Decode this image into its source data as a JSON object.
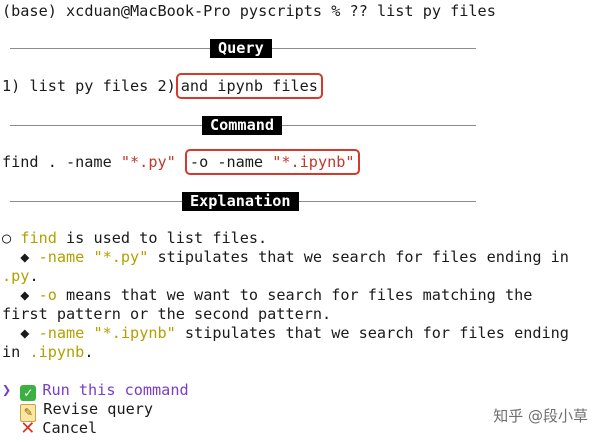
{
  "prompt": {
    "env": "(base)",
    "user_host": "xcduan@MacBook-Pro",
    "cwd": "pyscripts",
    "symbol": "%",
    "command": "?? list py files"
  },
  "sections": {
    "query": "Query",
    "command": "Command",
    "explanation": "Explanation"
  },
  "query": {
    "part1": "1) list py files 2)",
    "part2": "and ipynb files"
  },
  "command": {
    "base": "find . -name",
    "arg1": "\"*.py\"",
    "flag": "-o -name",
    "arg2": "\"*.ipynb\""
  },
  "explanation": {
    "bullet_main": "○",
    "bullet_sub": "◆",
    "l1_code": "find",
    "l1_text": " is used to list files.",
    "l2_code": "-name \"*.py\"",
    "l2_text": " stipulates that we search for files ending in",
    "l3_code": ".py",
    "l3_text": ".",
    "l4_code": "-o",
    "l4_text": " means that we want to search for files matching the",
    "l5_text": "first pattern or the second pattern.",
    "l6_code": "-name \"*.ipynb\"",
    "l6_text": " stipulates that we search for files ending",
    "l7_pre": "in ",
    "l7_code": ".ipynb",
    "l7_text": "."
  },
  "menu": {
    "pointer": "❯",
    "items": [
      {
        "icon": "check-mark-button-icon",
        "label": "Run this command"
      },
      {
        "icon": "memo-icon",
        "label": "Revise query"
      },
      {
        "icon": "cross-mark-icon",
        "label": "Cancel"
      }
    ]
  },
  "watermark": "知乎 @段小草",
  "colors": {
    "highlight_box": "#d33a2c",
    "code_yellow": "#b2a100",
    "string_red": "#c0392b",
    "menu_purple": "#7a3dc8",
    "header_bg": "#000000"
  }
}
